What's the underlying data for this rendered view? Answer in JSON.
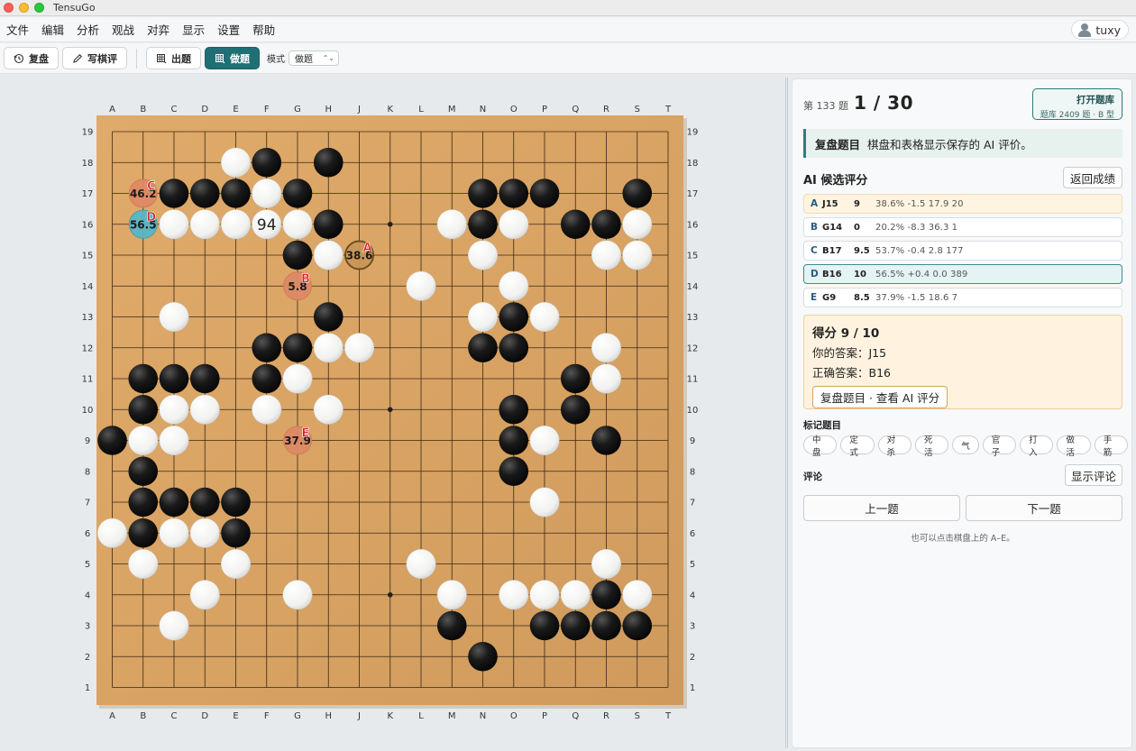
{
  "window": {
    "title": "TensuGo"
  },
  "menu": [
    "文件",
    "编辑",
    "分析",
    "观战",
    "对弈",
    "显示",
    "设置",
    "帮助"
  ],
  "user": {
    "name": "tuxy",
    "icon": "user-icon"
  },
  "toolbar": {
    "review_label": "复盘",
    "comment_label": "写棋评",
    "make_label": "出题",
    "solve_label": "做题",
    "mode_label": "模式",
    "mode_value": "做题"
  },
  "board": {
    "size": 19,
    "columns": [
      "A",
      "B",
      "C",
      "D",
      "E",
      "F",
      "G",
      "H",
      "J",
      "K",
      "L",
      "M",
      "N",
      "O",
      "P",
      "Q",
      "R",
      "S",
      "T"
    ],
    "rows": [
      "19",
      "18",
      "17",
      "16",
      "15",
      "14",
      "13",
      "12",
      "11",
      "10",
      "9",
      "8",
      "7",
      "6",
      "5",
      "4",
      "3",
      "2",
      "1"
    ],
    "black": [
      "F18",
      "H18",
      "C17",
      "D17",
      "E17",
      "G17",
      "N17",
      "O17",
      "P17",
      "S17",
      "H16",
      "N16",
      "Q16",
      "R16",
      "G15",
      "H13",
      "O13",
      "F12",
      "G12",
      "N12",
      "O12",
      "B11",
      "C11",
      "D11",
      "F11",
      "Q11",
      "B10",
      "O10",
      "Q10",
      "A9",
      "O9",
      "R9",
      "B8",
      "O8",
      "B7",
      "C7",
      "D7",
      "E7",
      "B6",
      "E6",
      "R4",
      "M3",
      "P3",
      "Q3",
      "R3",
      "S3",
      "N2"
    ],
    "white": [
      "E18",
      "F17",
      "C16",
      "D16",
      "E16",
      "G16",
      "F16",
      "M16",
      "O16",
      "S16",
      "H15",
      "N15",
      "R15",
      "S15",
      "L14",
      "O14",
      "C13",
      "N13",
      "P13",
      "H12",
      "J12",
      "R12",
      "G11",
      "R11",
      "C10",
      "D10",
      "F10",
      "H10",
      "B9",
      "C9",
      "P9",
      "P7",
      "A6",
      "C6",
      "D6",
      "B5",
      "E5",
      "L5",
      "R5",
      "D4",
      "G4",
      "M4",
      "O4",
      "P4",
      "Q4",
      "S4",
      "C3"
    ],
    "star_points": [
      "K16",
      "K10",
      "K4"
    ],
    "move_number": {
      "point": "F16",
      "label": "94"
    },
    "candidates": [
      {
        "letter": "A",
        "point": "J15",
        "value": "38.6",
        "fill": "#c9975a",
        "border": "#6b4b1f"
      },
      {
        "letter": "B",
        "point": "G14",
        "value": "5.8",
        "fill": "#de8a66",
        "border": "#d47a55"
      },
      {
        "letter": "C",
        "point": "B17",
        "value": "46.2",
        "fill": "#de8a66",
        "border": "#d47a55"
      },
      {
        "letter": "D",
        "point": "B16",
        "value": "56.5",
        "fill": "#5bb6c6",
        "border": "#3f9fb0"
      },
      {
        "letter": "E",
        "point": "G9",
        "value": "37.9",
        "fill": "#de8a66",
        "border": "#d47a55"
      }
    ]
  },
  "panel": {
    "problem_no": "第 133 题",
    "problem_count": "1 / 30",
    "open_lib": {
      "title": "打开题库",
      "sub": "题库 2409 题 · B 型"
    },
    "banner": {
      "title": "复盘题目",
      "text": "棋盘和表格显示保存的 AI 评价。"
    },
    "ai_title": "AI 候选评分",
    "back_label": "返回成绩",
    "candidates": [
      {
        "letter": "A",
        "move": "J15",
        "score": "9",
        "rest": "38.6%  -1.5  17.9  20"
      },
      {
        "letter": "B",
        "move": "G14",
        "score": "0",
        "rest": "20.2%  -8.3  36.3  1"
      },
      {
        "letter": "C",
        "move": "B17",
        "score": "9.5",
        "rest": "53.7%  -0.4  2.8  177"
      },
      {
        "letter": "D",
        "move": "B16",
        "score": "10",
        "rest": "56.5%  +0.4  0.0  389"
      },
      {
        "letter": "E",
        "move": "G9",
        "score": "8.5",
        "rest": "37.9%  -1.5  18.6  7"
      }
    ],
    "score": {
      "title": "得分 9 / 10",
      "your_answer": "你的答案：J15",
      "correct_answer": "正确答案：B16",
      "review_btn": "复盘题目 · 查看 AI 评分"
    },
    "tags_title": "标记题目",
    "tags": [
      "中盘",
      "定式",
      "对杀",
      "死活",
      "气",
      "官子",
      "打入",
      "做活",
      "手筋"
    ],
    "comment_title": "评论",
    "show_comment": "显示评论",
    "prev_label": "上一题",
    "next_label": "下一题",
    "hint": "也可以点击棋盘上的 A–E。"
  },
  "colors": {
    "accent": "#1f6f75",
    "board": "#d9a464",
    "highlight": "#fff4e0"
  }
}
